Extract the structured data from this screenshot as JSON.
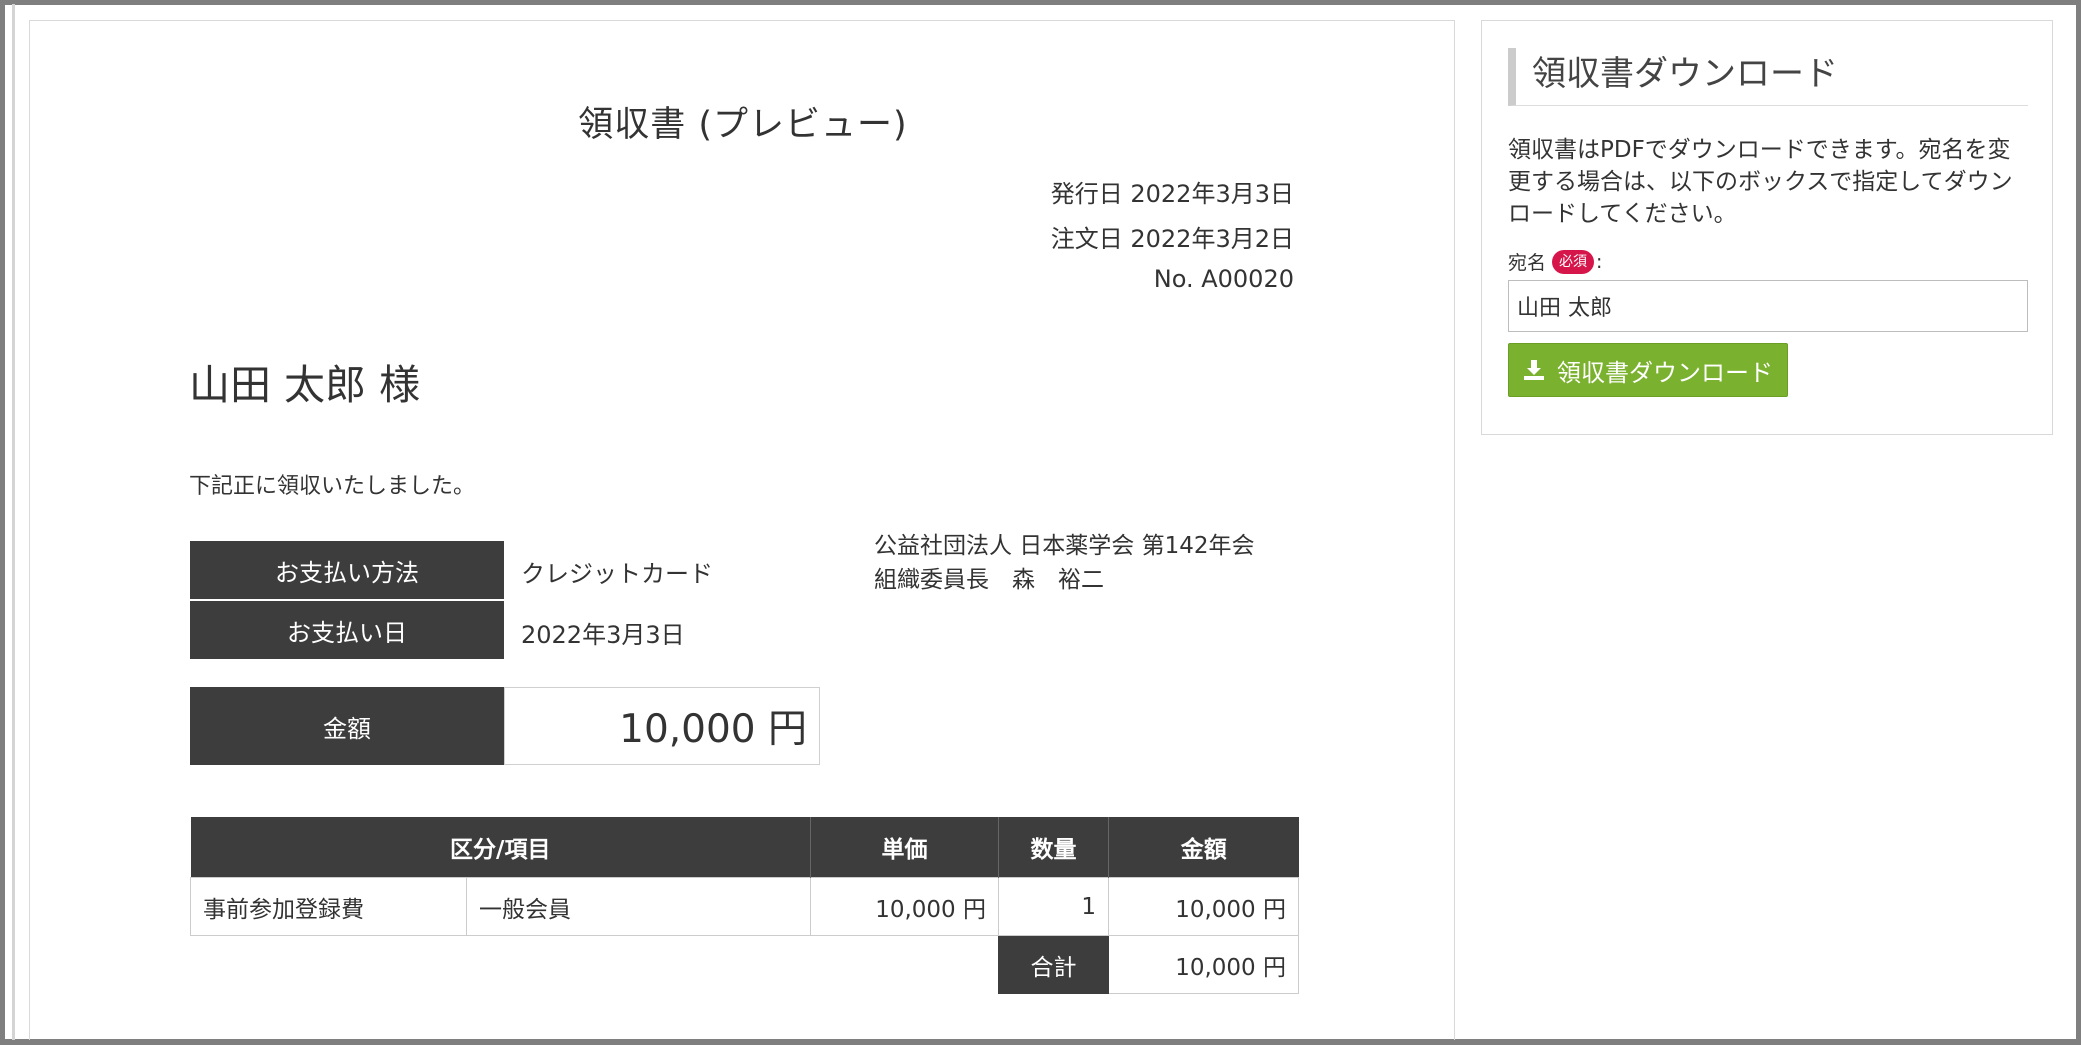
{
  "receipt": {
    "title": "領収書 (プレビュー)",
    "issue_date": "発行日 2022年3月3日",
    "order_date": "注文日 2022年3月2日",
    "number": "No. A00020",
    "recipient": "山田 太郎 様",
    "lead_text": "下記正に領収いたしました。",
    "payment_method_label": "お支払い方法",
    "payment_method_value": "クレジットカード",
    "payment_date_label": "お支払い日",
    "payment_date_value": "2022年3月3日",
    "issuer_line1": "公益社団法人 日本薬学会 第142年会",
    "issuer_line2": "組織委員長　森　裕二",
    "amount_label": "金額",
    "amount_value": "10,000 円",
    "items_table": {
      "headers": [
        "区分/項目",
        "単価",
        "数量",
        "金額"
      ],
      "rows": [
        {
          "category": "事前参加登録費",
          "item": "一般会員",
          "unit_price": "10,000 円",
          "quantity": "1",
          "amount": "10,000 円"
        }
      ],
      "total_label": "合計",
      "total_value": "10,000 円"
    }
  },
  "download_panel": {
    "title": "領収書ダウンロード",
    "description": "領収書はPDFでダウンロードできます。宛名を変更する場合は、以下のボックスで指定してダウンロードしてください。",
    "field_label": "宛名",
    "required_badge": "必須",
    "field_colon": ":",
    "name_value": "山田 太郎",
    "button_label": "領収書ダウンロード",
    "button_icon": "download-icon",
    "button_color": "#7ab12e",
    "badge_color": "#d6164a"
  }
}
